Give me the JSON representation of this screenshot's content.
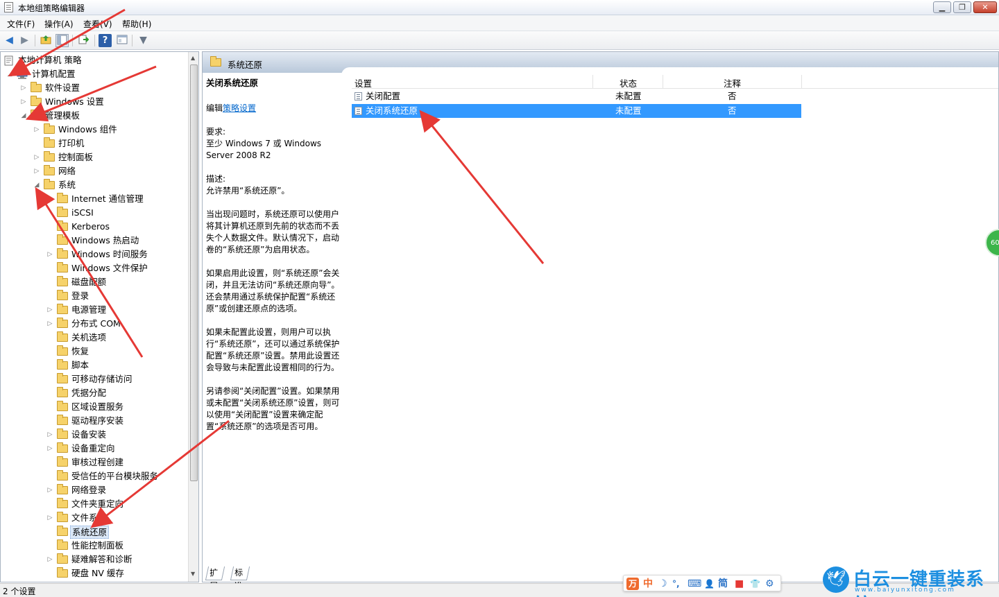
{
  "window": {
    "title": "本地组策略编辑器",
    "minimize": "▁",
    "maximize": "❐",
    "close": "✕"
  },
  "menu": [
    "文件(F)",
    "操作(A)",
    "查看(V)",
    "帮助(H)"
  ],
  "toolbar": {
    "back_icon": "◀",
    "forward_icon": "▶",
    "help_icon": "?",
    "filter_icon": "▼"
  },
  "tree": {
    "root": "本地计算机 策略",
    "computer_config": "计算机配置",
    "software_settings": "软件设置",
    "windows_settings": "Windows 设置",
    "admin_templates": "管理模板",
    "windows_components": "Windows 组件",
    "printers": "打印机",
    "control_panel": "控制面板",
    "network": "网络",
    "system": "系统",
    "system_children": [
      "Internet 通信管理",
      "iSCSI",
      "Kerberos",
      "Windows 热启动",
      "Windows 时间服务",
      "Windows 文件保护",
      "磁盘配额",
      "登录",
      "电源管理",
      "分布式 COM",
      "关机选项",
      "恢复",
      "脚本",
      "可移动存储访问",
      "凭据分配",
      "区域设置服务",
      "驱动程序安装",
      "设备安装",
      "设备重定向",
      "审核过程创建",
      "受信任的平台模块服务",
      "网络登录",
      "文件夹重定向",
      "文件系统",
      "系统还原",
      "性能控制面板",
      "疑难解答和诊断",
      "硬盘 NV 缓存"
    ]
  },
  "right_panel": {
    "header": "系统还原",
    "description": {
      "title": "关闭系统还原",
      "edit_prefix": "编辑",
      "edit_link": "策略设置",
      "requirements_label": "要求:",
      "requirements": "至少 Windows 7 或 Windows Server 2008 R2",
      "description_label": "描述:",
      "description": "允许禁用“系统还原”。",
      "para1": "当出现问题时，系统还原可以使用户将其计算机还原到先前的状态而不丢失个人数据文件。默认情况下，启动卷的“系统还原”为启用状态。",
      "para2": "如果启用此设置，则“系统还原”会关闭，并且无法访问“系统还原向导”。还会禁用通过系统保护配置“系统还原”或创建还原点的选项。",
      "para3": "如果未配置此设置，则用户可以执行“系统还原”，还可以通过系统保护配置“系统还原”设置。禁用此设置还会导致与未配置此设置相同的行为。",
      "para4": "另请参阅“关闭配置”设置。如果禁用或未配置“关闭系统还原”设置，则可以使用“关闭配置”设置来确定配置“系统还原”的选项是否可用。"
    },
    "columns": [
      "设置",
      "状态",
      "注释"
    ],
    "rows": [
      {
        "setting": "关闭配置",
        "state": "未配置",
        "comment": "否"
      },
      {
        "setting": "关闭系统还原",
        "state": "未配置",
        "comment": "否"
      }
    ],
    "tabs": [
      "扩展",
      "标准"
    ]
  },
  "status": "2 个设置",
  "ime": {
    "logo": "万",
    "lang": "中",
    "moon": "☽",
    "punct": "°,",
    "keyboard": "⌨",
    "user": "👤",
    "simplified": "简",
    "tool1": "■",
    "tool2": "👕",
    "settings": "⚙"
  },
  "watermark": {
    "text": "白云一键重装系统",
    "url": "www.baiyunxitong.com",
    "bird": "🕊"
  },
  "badge": "60",
  "colors": {
    "selection": "#3399ff",
    "annotation_arrow": "#e53935",
    "link": "#0066cc",
    "header_gradient_top": "#e3eaf3",
    "header_gradient_bottom": "#b9c8da"
  }
}
